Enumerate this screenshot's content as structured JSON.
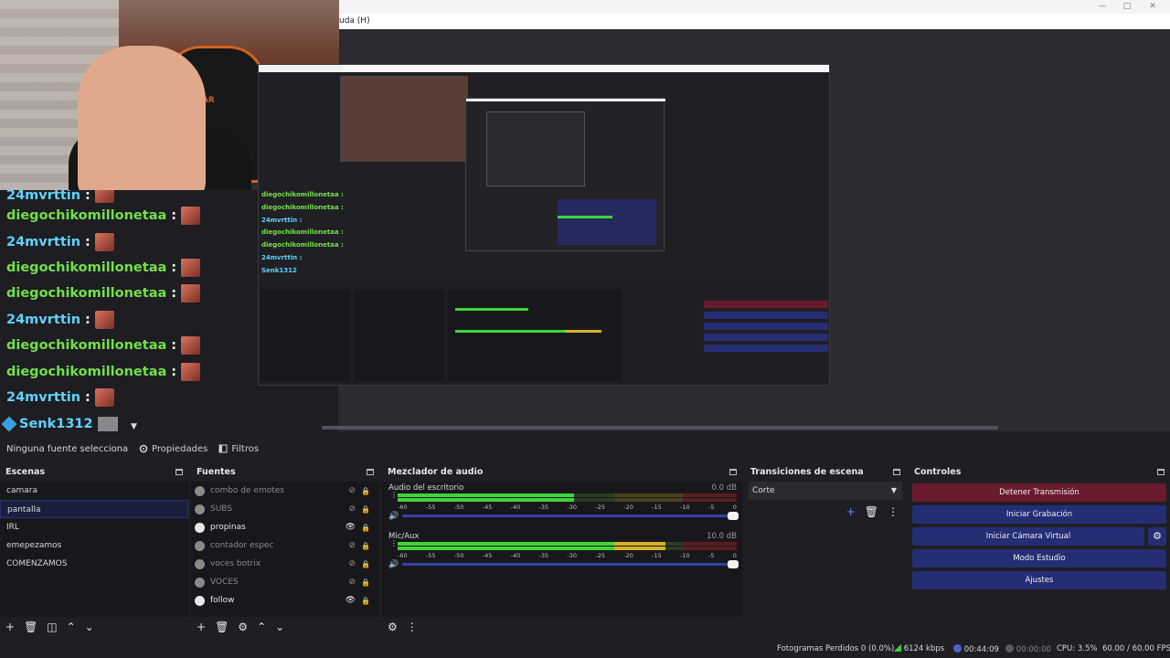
{
  "window": {
    "title_fragment": "uda (H)"
  },
  "chat": {
    "top_partial": {
      "user": "24mvrttin",
      "color": "cyan"
    },
    "lines": [
      {
        "user": "diegochikomillonetaa",
        "color": "green"
      },
      {
        "user": "24mvrttin",
        "color": "cyan"
      },
      {
        "user": "diegochikomillonetaa",
        "color": "green"
      },
      {
        "user": "diegochikomillonetaa",
        "color": "green"
      },
      {
        "user": "24mvrttin",
        "color": "cyan"
      },
      {
        "user": "diegochikomillonetaa",
        "color": "green"
      },
      {
        "user": "diegochikomillonetaa",
        "color": "green"
      },
      {
        "user": "24mvrttin",
        "color": "cyan"
      }
    ],
    "colon": ":",
    "last_user": "Senk1312"
  },
  "nested_preview": {
    "chat_lines": [
      {
        "user": "diegochikomillonetaa :",
        "color": "green"
      },
      {
        "user": "diegochikomillonetaa :",
        "color": "green"
      },
      {
        "user": "24mvrttin :",
        "color": "cyan"
      },
      {
        "user": "diegochikomillonetaa :",
        "color": "green"
      },
      {
        "user": "diegochikomillonetaa :",
        "color": "green"
      },
      {
        "user": "24mvrttin :",
        "color": "cyan"
      }
    ],
    "last_user": "Senk1312"
  },
  "props_bar": {
    "no_source": "Ninguna fuente seleccionada",
    "properties": "Propiedades",
    "filters": "Filtros"
  },
  "scenes": {
    "title": "Escenas",
    "items": [
      "camara",
      "pantalla",
      "IRL",
      "emepezamos",
      "COMENZAMOS"
    ],
    "selected_index": 1
  },
  "sources": {
    "title": "Fuentes",
    "items": [
      {
        "label": "combo de emotes",
        "visible": false,
        "locked": false
      },
      {
        "label": "SUBS",
        "visible": false,
        "locked": false
      },
      {
        "label": "propinas",
        "visible": true,
        "locked": false
      },
      {
        "label": "contador espec",
        "visible": false,
        "locked": false
      },
      {
        "label": "voces botrix",
        "visible": false,
        "locked": false
      },
      {
        "label": "VOCES",
        "visible": false,
        "locked": true
      },
      {
        "label": "follow",
        "visible": true,
        "locked": false
      }
    ]
  },
  "mixer": {
    "title": "Mezclador de audio",
    "channels": [
      {
        "name": "Audio del escritorio",
        "db": "0.0 dB",
        "level": 0.52
      },
      {
        "name": "Mic/Aux",
        "db": "10.0 dB",
        "level": 0.79
      }
    ],
    "scale": [
      "-60",
      "-55",
      "-50",
      "-45",
      "-40",
      "-35",
      "-30",
      "-25",
      "-20",
      "-15",
      "-10",
      "-5",
      "0"
    ]
  },
  "transitions": {
    "title": "Transiciones de escena",
    "selected": "Corte"
  },
  "controls": {
    "title": "Controles",
    "stop_stream": "Detener Transmisión",
    "start_recording": "Iniciar Grabación",
    "start_virtual_cam": "Iniciar Cámara Virtual",
    "studio_mode": "Modo Estudio",
    "settings": "Ajustes"
  },
  "status": {
    "dropped_frames": "Fotogramas Perdidos 0 (0.0%)",
    "bitrate": "6124 kbps",
    "live_time": "00:44:09",
    "rec_time": "00:00:00",
    "cpu": "CPU: 3.5%",
    "fps": "60.00 / 60.00 FPS"
  },
  "colors": {
    "chat_green": "#74e04a",
    "chat_cyan": "#5fd3ff",
    "button_blue": "#252d75",
    "button_stop": "#6a1a2d",
    "meter_green": "#3fd43a",
    "meter_yellow": "#d8b02a",
    "meter_red": "#c62a2a"
  }
}
